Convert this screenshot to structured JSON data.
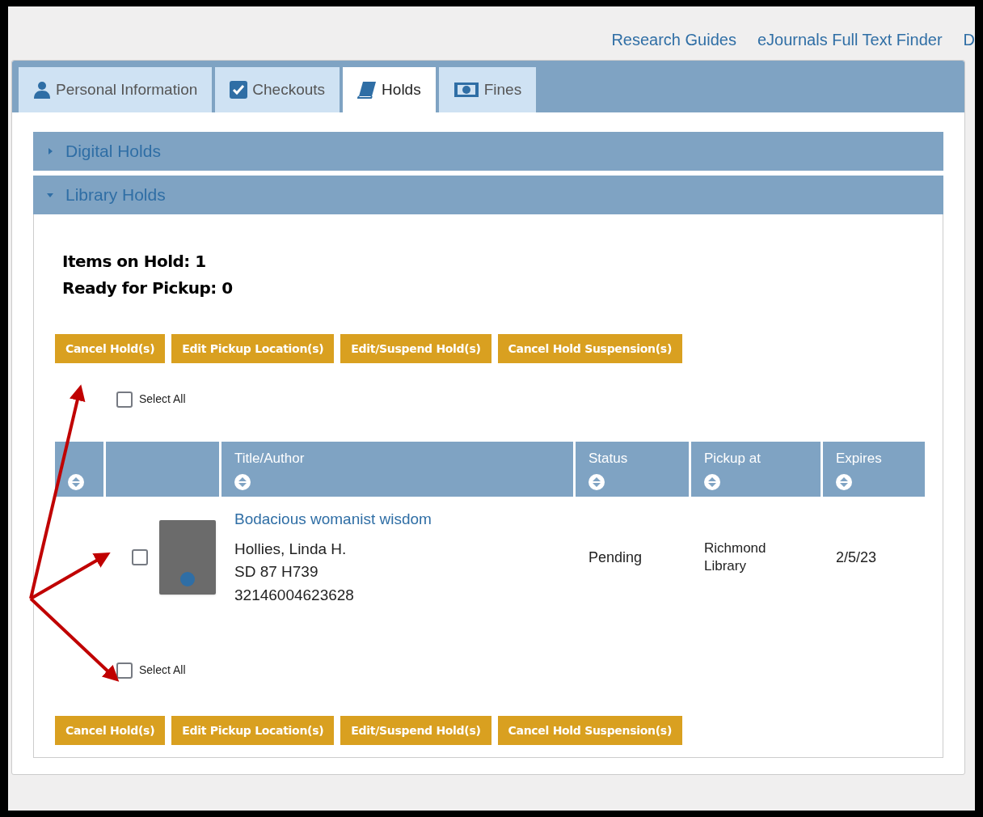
{
  "top_links": [
    "Research Guides",
    "eJournals Full Text Finder",
    "D"
  ],
  "tabs": [
    {
      "label": "Personal Information",
      "selected": false
    },
    {
      "label": "Checkouts",
      "selected": false
    },
    {
      "label": "Holds",
      "selected": true
    },
    {
      "label": "Fines",
      "selected": false
    }
  ],
  "sections": [
    {
      "title": "Digital Holds",
      "expanded": false
    },
    {
      "title": "Library Holds",
      "expanded": true
    }
  ],
  "summary": [
    "Items on Hold: 1",
    "Ready for Pickup: 0"
  ],
  "buttons_top": [
    "Cancel Hold(s)",
    "Edit Pickup Location(s)",
    "Edit/Suspend Hold(s)",
    "Cancel Hold Suspension(s)"
  ],
  "select_all_top": {
    "label": "Select All",
    "checked": false
  },
  "table": {
    "columns": [
      "",
      "",
      "Title/Author",
      "Status",
      "Pickup at",
      "Expires"
    ],
    "rows": [
      {
        "checked": false,
        "title": "Bodacious womanist wisdom",
        "author": "Hollies, Linda H.",
        "call_number": "SD 87 H739",
        "barcode": "32146004623628",
        "status": "Pending",
        "pickup": [
          "Richmond",
          "Library"
        ],
        "expires": "2/5/23"
      }
    ]
  },
  "select_all_bottom": {
    "label": "Select All",
    "checked": false
  },
  "buttons_bottom": [
    "Cancel Hold(s)",
    "Edit Pickup Location(s)",
    "Edit/Suspend Hold(s)",
    "Cancel Hold Suspension(s)"
  ]
}
